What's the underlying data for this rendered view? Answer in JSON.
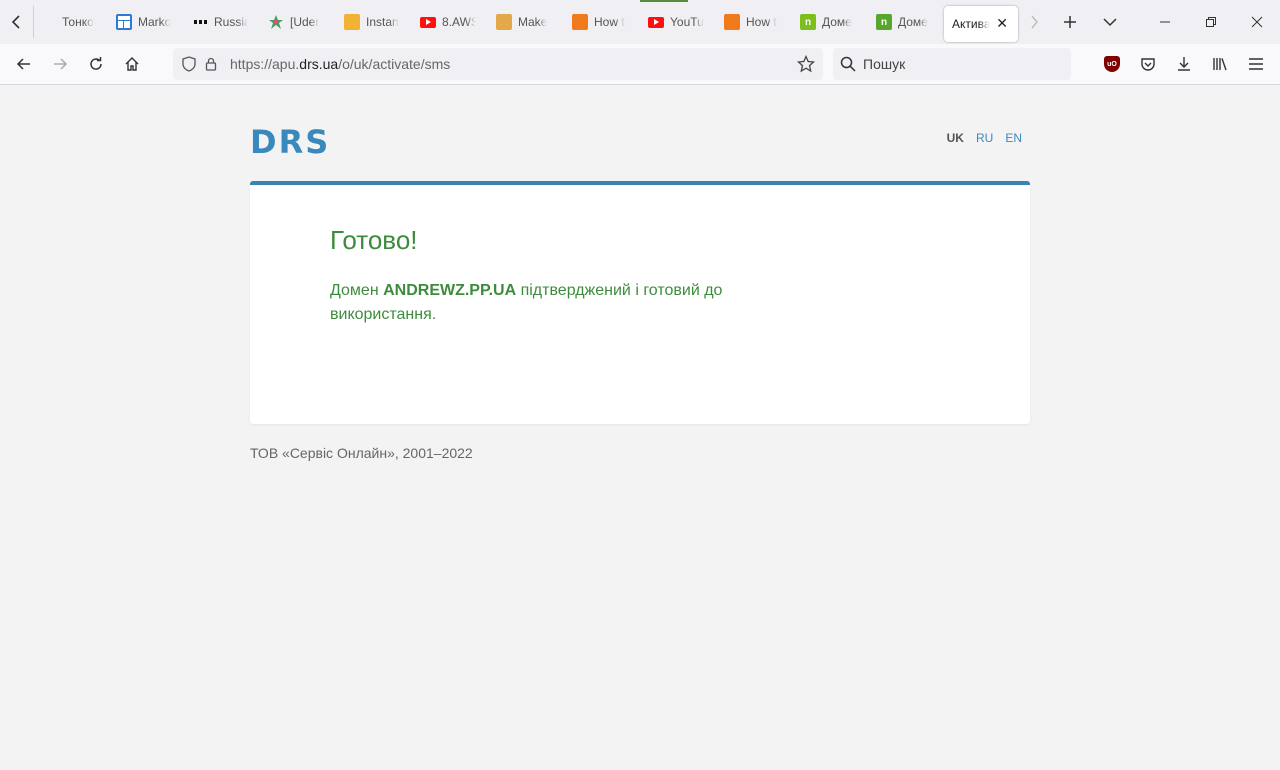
{
  "browser": {
    "tabs": [
      {
        "title": "Тонко",
        "favicon": "blank-favicon"
      },
      {
        "title": "Marko",
        "favicon": "markdown-favicon"
      },
      {
        "title": "Russia",
        "favicon": "russia-favicon"
      },
      {
        "title": "[Uder",
        "favicon": "udemy-favicon"
      },
      {
        "title": "Instan",
        "favicon": "box-favicon"
      },
      {
        "title": "8.AWS",
        "favicon": "youtube-favicon"
      },
      {
        "title": "Make",
        "favicon": "make-favicon"
      },
      {
        "title": "How t",
        "favicon": "cube-favicon"
      },
      {
        "title": "YouTu",
        "favicon": "youtube-favicon"
      },
      {
        "title": "How t",
        "favicon": "cube-favicon"
      },
      {
        "title": "Доме",
        "favicon": "n-favicon"
      },
      {
        "title": "Доме",
        "favicon": "n-favicon"
      }
    ],
    "active_tab": {
      "title": "Актива",
      "close_glyph": "✕"
    },
    "url": {
      "prefix": "https://apu.",
      "host": "drs.ua",
      "path": "/o/uk/activate/sms"
    },
    "search": {
      "placeholder": "Пошук"
    }
  },
  "page": {
    "logo": "DRS",
    "languages": [
      {
        "code": "UK",
        "current": true
      },
      {
        "code": "RU",
        "current": false
      },
      {
        "code": "EN",
        "current": false
      }
    ],
    "card": {
      "title": "Готово!",
      "message_before": "Домен ",
      "domain": "ANDREWZ.PP.UA",
      "message_after": " підтверджений і готовий до використання."
    },
    "footer": "ТОВ «Сервіс Онлайн», 2001–2022"
  },
  "colors": {
    "accent_blue": "#3a89bc",
    "success_green": "#3d8c3d",
    "page_bg": "#f3f3f3"
  }
}
